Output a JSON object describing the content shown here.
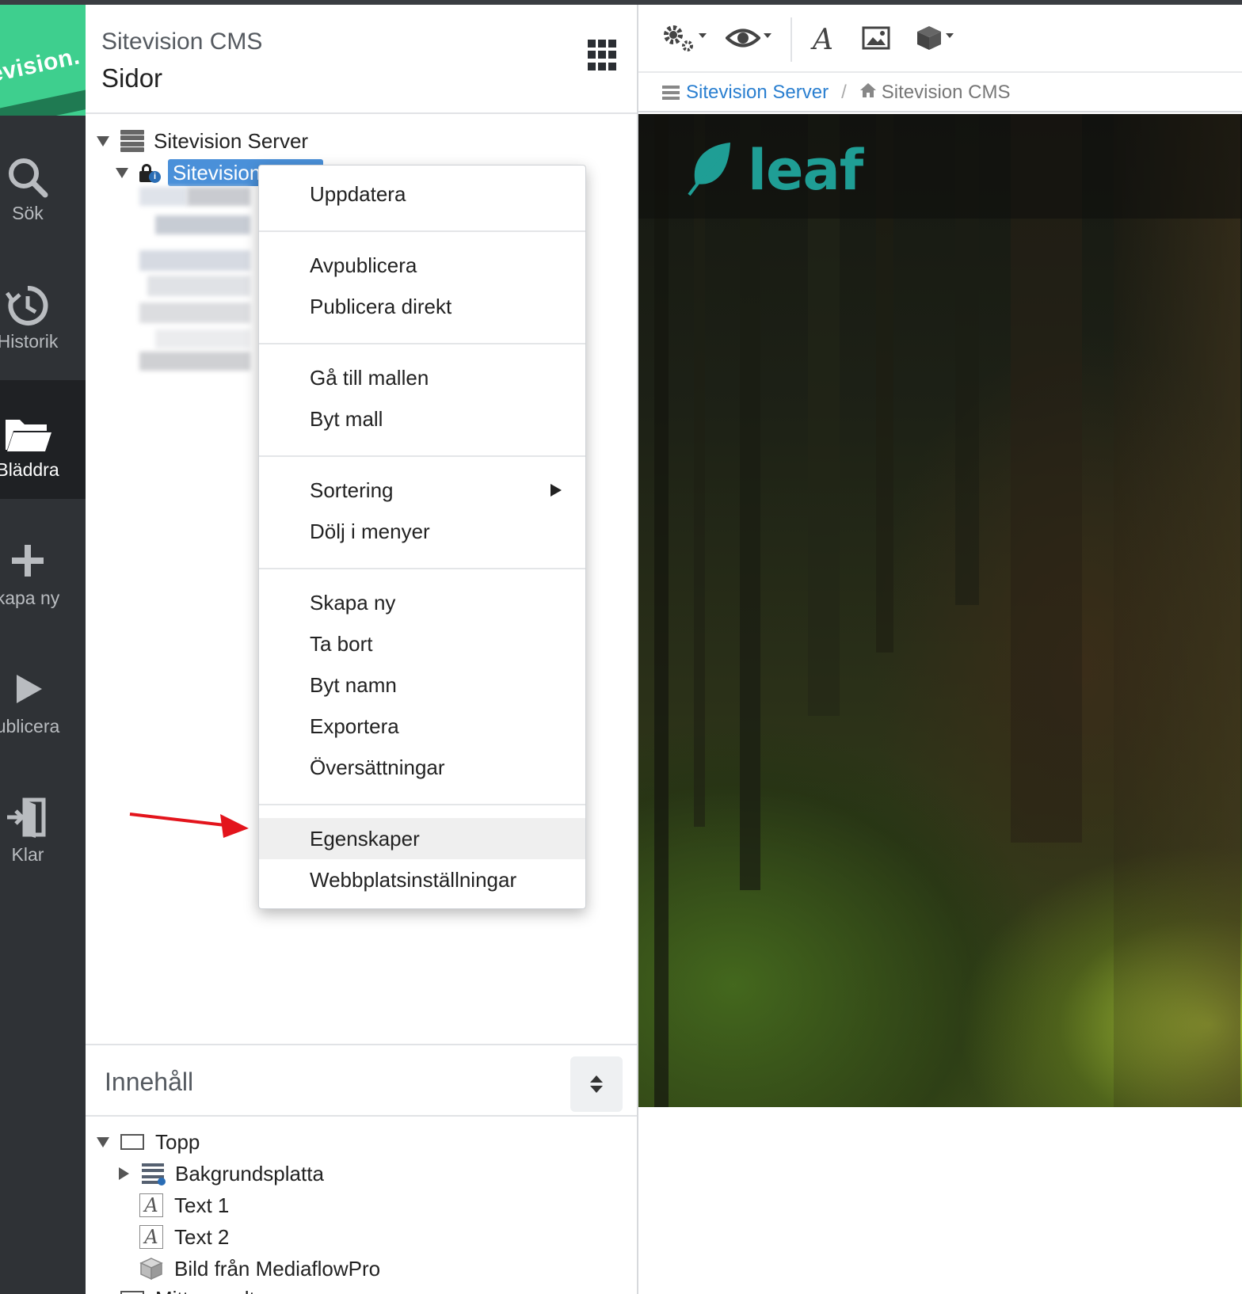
{
  "rail": {
    "logo_text": "evision.",
    "items": [
      {
        "label": "Sök",
        "icon": "search-icon"
      },
      {
        "label": "Historik",
        "icon": "history-icon"
      },
      {
        "label": "Bläddra",
        "icon": "folder-icon"
      },
      {
        "label": "kapa ny",
        "icon": "plus-icon"
      },
      {
        "label": "ublicera",
        "icon": "play-icon"
      },
      {
        "label": "Klar",
        "icon": "exit-icon"
      }
    ]
  },
  "sidebar": {
    "app_name": "Sitevision CMS",
    "title": "Sidor",
    "tree": {
      "server": "Sitevision Server",
      "site_selected": "Sitevision CMS"
    },
    "content": {
      "title": "Innehåll",
      "items": [
        "Topp",
        "Bakgrundsplatta",
        "Text 1",
        "Text 2",
        "Bild från MediaflowPro",
        "Mittenspalt"
      ]
    }
  },
  "context_menu": {
    "groups": [
      [
        "Uppdatera"
      ],
      [
        "Avpublicera",
        "Publicera direkt"
      ],
      [
        "Gå till mallen",
        "Byt mall"
      ],
      [
        "Sortering",
        "Dölj i menyer"
      ],
      [
        "Skapa ny",
        "Ta bort",
        "Byt namn",
        "Exportera",
        "Översättningar"
      ],
      [
        "Egenskaper",
        "Webbplatsinställningar"
      ]
    ],
    "highlighted": "Egenskaper",
    "submenu_item": "Sortering"
  },
  "breadcrumb": {
    "server": "Sitevision Server",
    "separator": "/",
    "current": "Sitevision CMS"
  },
  "preview": {
    "logo_text": "leaf",
    "logo_color": "#1f9e95"
  },
  "colors": {
    "brand_green": "#3ecf8e",
    "selection_blue": "#4a90d9",
    "link_blue": "#2a7fd0",
    "annotation_red": "#e3141c"
  }
}
